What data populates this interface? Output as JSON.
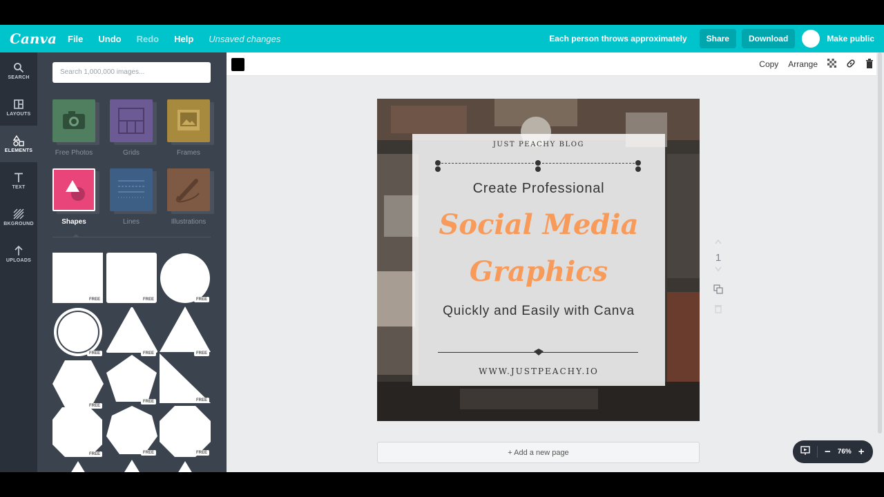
{
  "app": {
    "logo": "Canva",
    "menu": [
      "File",
      "Undo",
      "Redo",
      "Help"
    ],
    "status": "Unsaved changes",
    "doc_title": "Each person throws approximately",
    "share_label": "Share",
    "download_label": "Download",
    "make_public_label": "Make public",
    "brand_color": "#00c4cc"
  },
  "rail": [
    {
      "label": "SEARCH",
      "icon": "search-icon"
    },
    {
      "label": "LAYOUTS",
      "icon": "layouts-icon"
    },
    {
      "label": "ELEMENTS",
      "icon": "elements-icon"
    },
    {
      "label": "TEXT",
      "icon": "text-icon"
    },
    {
      "label": "BKGROUND",
      "icon": "background-icon"
    },
    {
      "label": "UPLOADS",
      "icon": "upload-icon"
    }
  ],
  "panel": {
    "search_placeholder": "Search 1,000,000 images...",
    "categories": [
      {
        "label": "Free Photos",
        "icon": "camera-icon"
      },
      {
        "label": "Grids",
        "icon": "grid-icon"
      },
      {
        "label": "Frames",
        "icon": "frame-icon"
      },
      {
        "label": "Shapes",
        "icon": "shapes-icon"
      },
      {
        "label": "Lines",
        "icon": "lines-icon"
      },
      {
        "label": "Illustrations",
        "icon": "pencil-icon"
      }
    ],
    "free_tag": "FREE"
  },
  "toolbar": {
    "copy_label": "Copy",
    "arrange_label": "Arrange"
  },
  "design": {
    "blog_name": "JUST PEACHY BLOG",
    "line1": "Create Professional",
    "script1": "Social Media",
    "script2": "Graphics",
    "line3": "Quickly and Easily with Canva",
    "url": "WWW.JUSTPEACHY.IO",
    "accent": "#f79a5a"
  },
  "page_number": "1",
  "add_page_label": "+ Add a new page",
  "zoom": "76%"
}
